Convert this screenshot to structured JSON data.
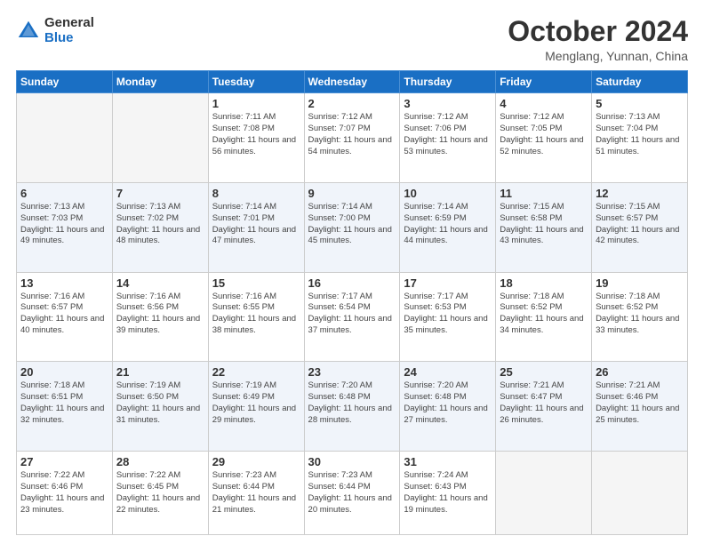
{
  "header": {
    "logo_general": "General",
    "logo_blue": "Blue",
    "month": "October 2024",
    "location": "Menglang, Yunnan, China"
  },
  "days_of_week": [
    "Sunday",
    "Monday",
    "Tuesday",
    "Wednesday",
    "Thursday",
    "Friday",
    "Saturday"
  ],
  "weeks": [
    [
      {
        "day": "",
        "empty": true
      },
      {
        "day": "",
        "empty": true
      },
      {
        "day": "1",
        "sunrise": "7:11 AM",
        "sunset": "7:08 PM",
        "daylight": "11 hours and 56 minutes."
      },
      {
        "day": "2",
        "sunrise": "7:12 AM",
        "sunset": "7:07 PM",
        "daylight": "11 hours and 54 minutes."
      },
      {
        "day": "3",
        "sunrise": "7:12 AM",
        "sunset": "7:06 PM",
        "daylight": "11 hours and 53 minutes."
      },
      {
        "day": "4",
        "sunrise": "7:12 AM",
        "sunset": "7:05 PM",
        "daylight": "11 hours and 52 minutes."
      },
      {
        "day": "5",
        "sunrise": "7:13 AM",
        "sunset": "7:04 PM",
        "daylight": "11 hours and 51 minutes."
      }
    ],
    [
      {
        "day": "6",
        "sunrise": "7:13 AM",
        "sunset": "7:03 PM",
        "daylight": "11 hours and 49 minutes."
      },
      {
        "day": "7",
        "sunrise": "7:13 AM",
        "sunset": "7:02 PM",
        "daylight": "11 hours and 48 minutes."
      },
      {
        "day": "8",
        "sunrise": "7:14 AM",
        "sunset": "7:01 PM",
        "daylight": "11 hours and 47 minutes."
      },
      {
        "day": "9",
        "sunrise": "7:14 AM",
        "sunset": "7:00 PM",
        "daylight": "11 hours and 45 minutes."
      },
      {
        "day": "10",
        "sunrise": "7:14 AM",
        "sunset": "6:59 PM",
        "daylight": "11 hours and 44 minutes."
      },
      {
        "day": "11",
        "sunrise": "7:15 AM",
        "sunset": "6:58 PM",
        "daylight": "11 hours and 43 minutes."
      },
      {
        "day": "12",
        "sunrise": "7:15 AM",
        "sunset": "6:57 PM",
        "daylight": "11 hours and 42 minutes."
      }
    ],
    [
      {
        "day": "13",
        "sunrise": "7:16 AM",
        "sunset": "6:57 PM",
        "daylight": "11 hours and 40 minutes."
      },
      {
        "day": "14",
        "sunrise": "7:16 AM",
        "sunset": "6:56 PM",
        "daylight": "11 hours and 39 minutes."
      },
      {
        "day": "15",
        "sunrise": "7:16 AM",
        "sunset": "6:55 PM",
        "daylight": "11 hours and 38 minutes."
      },
      {
        "day": "16",
        "sunrise": "7:17 AM",
        "sunset": "6:54 PM",
        "daylight": "11 hours and 37 minutes."
      },
      {
        "day": "17",
        "sunrise": "7:17 AM",
        "sunset": "6:53 PM",
        "daylight": "11 hours and 35 minutes."
      },
      {
        "day": "18",
        "sunrise": "7:18 AM",
        "sunset": "6:52 PM",
        "daylight": "11 hours and 34 minutes."
      },
      {
        "day": "19",
        "sunrise": "7:18 AM",
        "sunset": "6:52 PM",
        "daylight": "11 hours and 33 minutes."
      }
    ],
    [
      {
        "day": "20",
        "sunrise": "7:18 AM",
        "sunset": "6:51 PM",
        "daylight": "11 hours and 32 minutes."
      },
      {
        "day": "21",
        "sunrise": "7:19 AM",
        "sunset": "6:50 PM",
        "daylight": "11 hours and 31 minutes."
      },
      {
        "day": "22",
        "sunrise": "7:19 AM",
        "sunset": "6:49 PM",
        "daylight": "11 hours and 29 minutes."
      },
      {
        "day": "23",
        "sunrise": "7:20 AM",
        "sunset": "6:48 PM",
        "daylight": "11 hours and 28 minutes."
      },
      {
        "day": "24",
        "sunrise": "7:20 AM",
        "sunset": "6:48 PM",
        "daylight": "11 hours and 27 minutes."
      },
      {
        "day": "25",
        "sunrise": "7:21 AM",
        "sunset": "6:47 PM",
        "daylight": "11 hours and 26 minutes."
      },
      {
        "day": "26",
        "sunrise": "7:21 AM",
        "sunset": "6:46 PM",
        "daylight": "11 hours and 25 minutes."
      }
    ],
    [
      {
        "day": "27",
        "sunrise": "7:22 AM",
        "sunset": "6:46 PM",
        "daylight": "11 hours and 23 minutes."
      },
      {
        "day": "28",
        "sunrise": "7:22 AM",
        "sunset": "6:45 PM",
        "daylight": "11 hours and 22 minutes."
      },
      {
        "day": "29",
        "sunrise": "7:23 AM",
        "sunset": "6:44 PM",
        "daylight": "11 hours and 21 minutes."
      },
      {
        "day": "30",
        "sunrise": "7:23 AM",
        "sunset": "6:44 PM",
        "daylight": "11 hours and 20 minutes."
      },
      {
        "day": "31",
        "sunrise": "7:24 AM",
        "sunset": "6:43 PM",
        "daylight": "11 hours and 19 minutes."
      },
      {
        "day": "",
        "empty": true
      },
      {
        "day": "",
        "empty": true
      }
    ]
  ]
}
